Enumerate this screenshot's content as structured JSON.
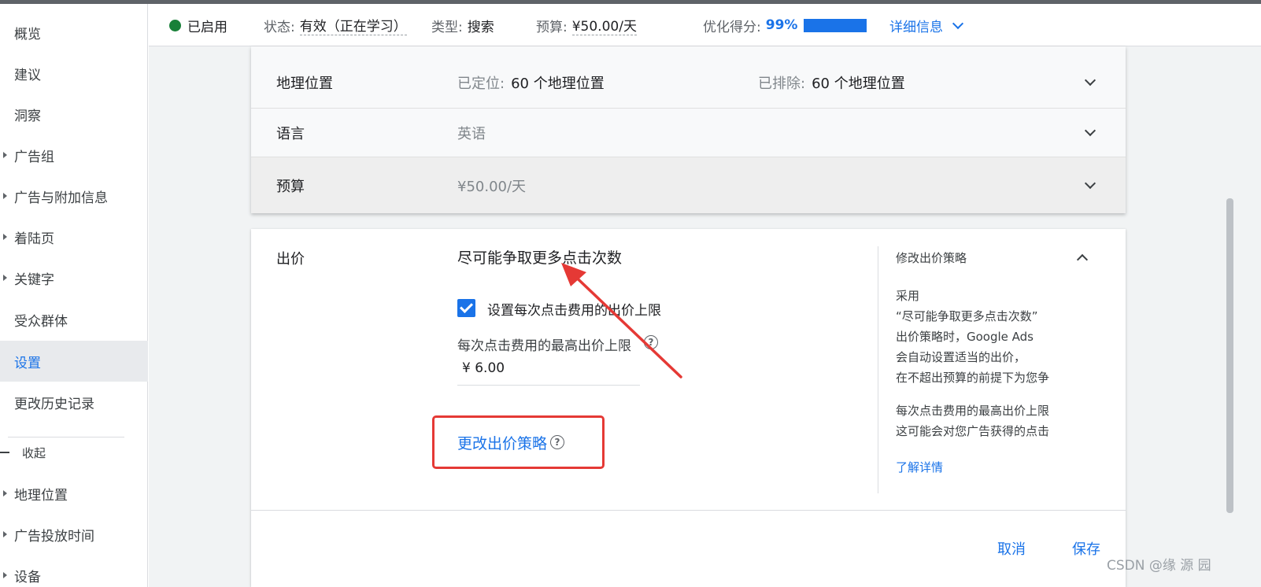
{
  "sidebar": {
    "items": [
      {
        "label": "概览"
      },
      {
        "label": "建议"
      },
      {
        "label": "洞察"
      },
      {
        "label": "广告组"
      },
      {
        "label": "广告与附加信息"
      },
      {
        "label": "着陆页"
      },
      {
        "label": "关键字"
      },
      {
        "label": "受众群体"
      },
      {
        "label": "设置"
      },
      {
        "label": "更改历史记录"
      }
    ],
    "collapse_label": "收起",
    "extra_items": [
      {
        "label": "地理位置"
      },
      {
        "label": "广告投放时间"
      },
      {
        "label": "设备"
      }
    ]
  },
  "statusbar": {
    "enabled_label": "已启用",
    "status_key": "状态:",
    "status_value": "有效（正在学习）",
    "type_key": "类型:",
    "type_value": "搜索",
    "budget_key": "预算:",
    "budget_value": "¥50.00/天",
    "opt_key": "优化得分:",
    "opt_value": "99%",
    "opt_fraction": 0.99,
    "details_link": "详细信息"
  },
  "settings": {
    "location": {
      "title": "地理位置",
      "targeted_key": "已定位:",
      "targeted_value": "60 个地理位置",
      "excluded_key": "已排除:",
      "excluded_value": "60 个地理位置"
    },
    "language": {
      "title": "语言",
      "value": "英语"
    },
    "budget": {
      "title": "预算",
      "value": "¥50.00/天"
    }
  },
  "bidding": {
    "title": "出价",
    "strategy": "尽可能争取更多点击次数",
    "checkbox_label": "设置每次点击费用的出价上限",
    "max_cpc_label": "每次点击费用的最高出价上限",
    "max_cpc_value": "¥ 6.00",
    "change_strategy_link": "更改出价策略",
    "side_panel": {
      "title": "修改出价策略",
      "para1": [
        "采用",
        "“尽可能争取更多点击次数”",
        "出价策略时，Google Ads",
        "会自动设置适当的出价，",
        "在不超出预算的前提下为您争"
      ],
      "para2": [
        "每次点击费用的最高出价上限",
        "这可能会对您广告获得的点击"
      ],
      "learn_more": "了解详情"
    },
    "cancel": "取消",
    "save": "保存"
  },
  "watermark": "CSDN @缘 源 园",
  "colors": {
    "accent": "#1a73e8",
    "enabled_green": "#188038",
    "annotation_red": "#e53935"
  }
}
